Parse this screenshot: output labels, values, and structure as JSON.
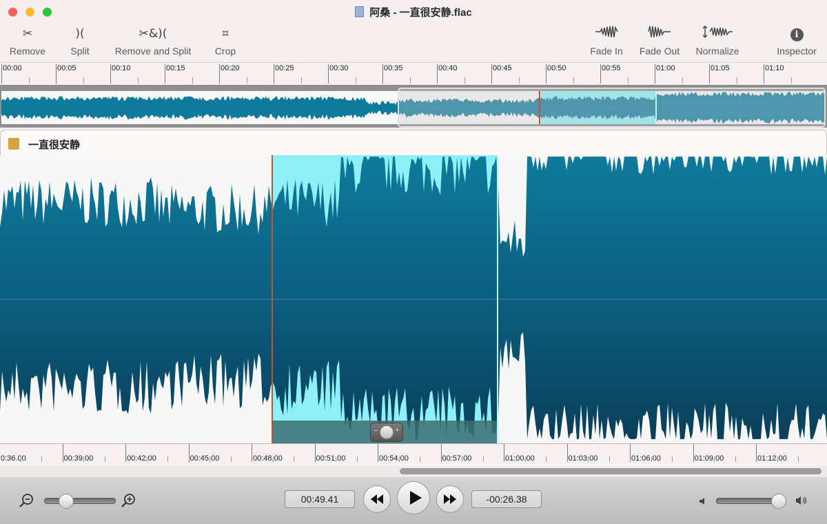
{
  "window": {
    "title": "阿桑 - 一直很安静.flac",
    "traffic_lights": {
      "close": "#fe5f57",
      "minimize": "#febc2e",
      "zoom": "#28c840"
    }
  },
  "toolbar": {
    "left": [
      {
        "id": "remove",
        "label": "Remove",
        "icon": "scissors-icon",
        "glyph": "✂"
      },
      {
        "id": "split",
        "label": "Split",
        "icon": "split-icon",
        "glyph": ")("
      },
      {
        "id": "remove-split",
        "label": "Remove and Split",
        "icon": "remove-and-split-icon",
        "glyph": "✂&)("
      },
      {
        "id": "crop",
        "label": "Crop",
        "icon": "crop-icon",
        "glyph": "⌗"
      }
    ],
    "right": [
      {
        "id": "fade-in",
        "label": "Fade In",
        "icon": "fade-in-icon",
        "glyph": "⁓∿∿"
      },
      {
        "id": "fade-out",
        "label": "Fade Out",
        "icon": "fade-out-icon",
        "glyph": "∿∿⁓"
      },
      {
        "id": "normalize",
        "label": "Normalize",
        "icon": "normalize-icon",
        "glyph": "↕∿∿"
      },
      {
        "id": "inspector",
        "label": "Inspector",
        "icon": "info-icon",
        "glyph": "i"
      }
    ]
  },
  "ruler_top": {
    "labels": [
      "00:00",
      "00:05",
      "00:10",
      "00:15",
      "00:20",
      "00:25",
      "00:30",
      "00:35",
      "00:40",
      "00:45",
      "00:50",
      "00:55",
      "01:00",
      "01:05",
      "01:10"
    ]
  },
  "file": {
    "name": "一直很安静"
  },
  "colors": {
    "wave": "#0f7a9b",
    "wave_dark": "#0a3f5a",
    "selection": "#8ef1f7",
    "playhead": "#c8532a",
    "background": "#f7f7f7"
  },
  "ruler_bottom": {
    "labels": [
      "0:36.00",
      "00:39.00",
      "00:42.00",
      "00:45.00",
      "00:48.00",
      "00:51.00",
      "00:54.00",
      "00:57.00",
      "01:00.00",
      "01:03.00",
      "01:06.00",
      "01:09.00",
      "01:12.00"
    ]
  },
  "transport": {
    "current_time": "00:49.41",
    "remaining_time": "-00:26.38",
    "zoom_level": 0.3,
    "volume_level": 0.9
  }
}
